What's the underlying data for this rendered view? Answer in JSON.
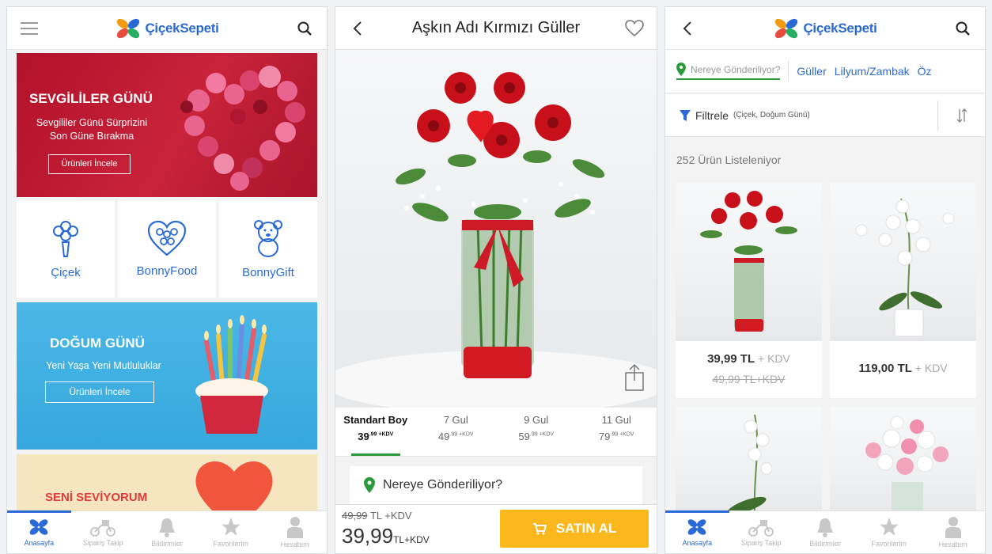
{
  "brand": {
    "name": "ÇiçekSepeti",
    "accent": "#2a6ad6",
    "cta": "#fbb81c",
    "green": "#2a9a3a"
  },
  "home": {
    "banner_valentine": {
      "title": "SEVGİLİLER GÜNÜ",
      "subtitle_1": "Sevgililer Günü Sürprizini",
      "subtitle_2": "Son Güne Bırakma",
      "button": "Ürünleri İncele"
    },
    "categories": [
      {
        "label": "Çiçek",
        "icon": "flower-bouquet-icon"
      },
      {
        "label": "BonnyFood",
        "icon": "heart-chocolate-box-icon"
      },
      {
        "label": "BonnyGift",
        "icon": "teddy-bear-icon"
      }
    ],
    "banner_birthday": {
      "title": "DOĞUM GÜNÜ",
      "subtitle": "Yeni Yaşa Yeni Mutluluklar",
      "button": "Ürünleri İncele"
    },
    "banner_love": {
      "title": "SENİ SEVİYORUM"
    }
  },
  "tabs": [
    {
      "label": "Anasayfa",
      "icon": "flower-logo-icon"
    },
    {
      "label": "Sipariş Takip",
      "icon": "scooter-icon"
    },
    {
      "label": "Bildirimler",
      "icon": "bell-icon"
    },
    {
      "label": "Favorilerim",
      "icon": "star-icon"
    },
    {
      "label": "Hesabım",
      "icon": "user-icon"
    }
  ],
  "product": {
    "title": "Aşkın Adı Kırmızı Güller",
    "sizes": [
      {
        "name": "Standart Boy",
        "price": "39",
        "cents": ".99 +KDV"
      },
      {
        "name": "7 Gul",
        "price": "49",
        "cents": ".99 +KDV"
      },
      {
        "name": "9 Gul",
        "price": "59",
        "cents": ".99 +KDV"
      },
      {
        "name": "11 Gul",
        "price": "79",
        "cents": ".99 +KDV"
      }
    ],
    "destination_label": "Nereye Gönderiliyor?",
    "old_price": "49,99",
    "old_price_suffix": "TL +KDV",
    "new_price": "39,99",
    "new_price_suffix": "TL+KDV",
    "buy_label": "SATIN AL"
  },
  "listing": {
    "location_placeholder": "Nereye Gönderiliyor?",
    "quick_tags": [
      "Güller",
      "Lilyum/Zambak",
      "Öz"
    ],
    "filter_label": "Filtrele",
    "filter_summary": "(Çiçek, Doğum Günü)",
    "count_text": "252 Ürün Listeleniyor",
    "products": [
      {
        "price": "39,99 TL",
        "kdv": "+ KDV",
        "old_price": "49,99 TL+KDV"
      },
      {
        "price": "119,00 TL",
        "kdv": "+ KDV",
        "old_price": ""
      }
    ]
  }
}
